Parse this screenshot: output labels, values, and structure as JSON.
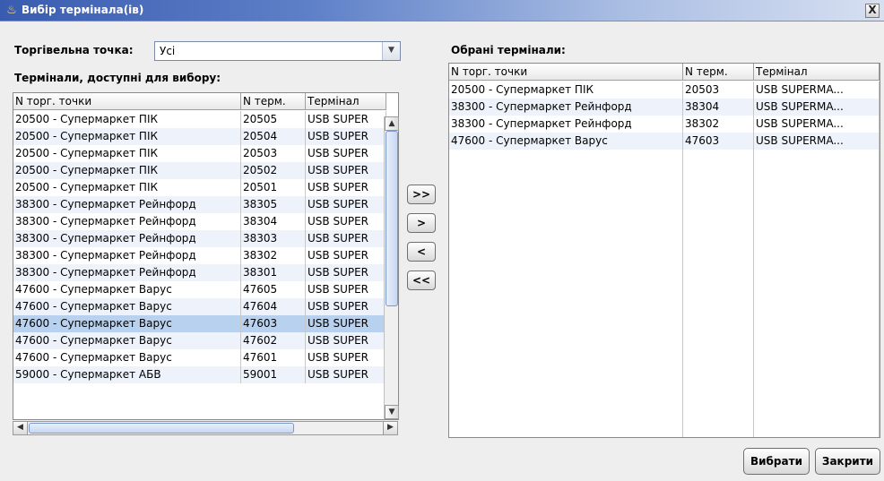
{
  "window": {
    "title": "Вибір термінала(ів)",
    "close_label": "X"
  },
  "filter": {
    "label": "Торгівельна точка:",
    "value": "Усі"
  },
  "available": {
    "label": "Термінали, доступні для вибору:",
    "columns": [
      "N торг. точки",
      "N терм.",
      "Термінал"
    ],
    "rows": [
      [
        "20500 - Супермаркет ПІК",
        "20505",
        "USB SUPER"
      ],
      [
        "20500 - Супермаркет ПІК",
        "20504",
        "USB SUPER"
      ],
      [
        "20500 - Супермаркет ПІК",
        "20503",
        "USB SUPER"
      ],
      [
        "20500 - Супермаркет ПІК",
        "20502",
        "USB SUPER"
      ],
      [
        "20500 - Супермаркет ПІК",
        "20501",
        "USB SUPER"
      ],
      [
        "38300 - Супермаркет Рейнфорд",
        "38305",
        "USB SUPER"
      ],
      [
        "38300 - Супермаркет Рейнфорд",
        "38304",
        "USB SUPER"
      ],
      [
        "38300 - Супермаркет Рейнфорд",
        "38303",
        "USB SUPER"
      ],
      [
        "38300 - Супермаркет Рейнфорд",
        "38302",
        "USB SUPER"
      ],
      [
        "38300 - Супермаркет Рейнфорд",
        "38301",
        "USB SUPER"
      ],
      [
        "47600 - Супермаркет Варус",
        "47605",
        "USB SUPER"
      ],
      [
        "47600 - Супермаркет Варус",
        "47604",
        "USB SUPER"
      ],
      [
        "47600 - Супермаркет Варус",
        "47603",
        "USB SUPER"
      ],
      [
        "47600 - Супермаркет Варус",
        "47602",
        "USB SUPER"
      ],
      [
        "47600 - Супермаркет Варус",
        "47601",
        "USB SUPER"
      ],
      [
        "59000 - Супермаркет АБВ",
        "59001",
        "USB SUPER"
      ]
    ],
    "selected_row": 12
  },
  "selected": {
    "label": "Обрані термінали:",
    "columns": [
      "N торг. точки",
      "N терм.",
      "Термінал"
    ],
    "rows": [
      [
        "20500 - Супермаркет ПІК",
        "20503",
        "USB SUPERMA..."
      ],
      [
        "38300 - Супермаркет Рейнфорд",
        "38304",
        "USB SUPERMA..."
      ],
      [
        "38300 - Супермаркет Рейнфорд",
        "38302",
        "USB SUPERMA..."
      ],
      [
        "47600 - Супермаркет Варус",
        "47603",
        "USB SUPERMA..."
      ]
    ]
  },
  "move_buttons": {
    "add_all": ">>",
    "add": ">",
    "remove": "<",
    "remove_all": "<<"
  },
  "actions": {
    "select": "Вибрати",
    "close": "Закрити"
  },
  "icons": {
    "window": "java-cup-icon",
    "scroll_up": "arrow-up-icon",
    "scroll_down": "arrow-down-icon",
    "scroll_left": "arrow-left-icon",
    "scroll_right": "arrow-right-icon",
    "combo": "dropdown-arrow-icon"
  }
}
